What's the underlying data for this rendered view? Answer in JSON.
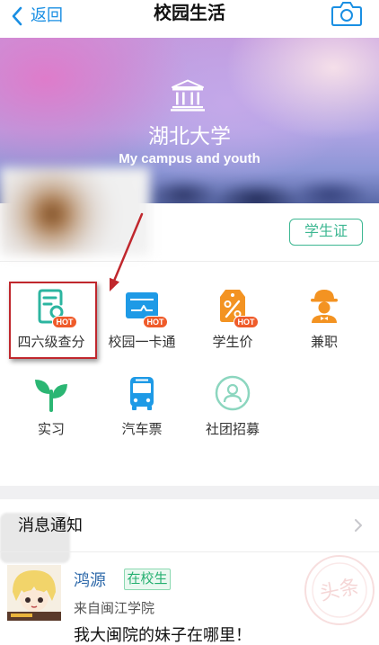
{
  "nav": {
    "back_label": "返回",
    "title": "校园生活",
    "back_icon": "chevron-left-icon",
    "camera_icon": "camera-icon"
  },
  "banner": {
    "icon": "university-building-icon",
    "school_name": "湖北大学",
    "slogan": "My campus and youth"
  },
  "profile": {
    "student_card_label": "学生证"
  },
  "services": {
    "items": [
      {
        "label": "四六级查分",
        "icon": "exam-score-search-icon",
        "badge": "HOT",
        "highlighted": true
      },
      {
        "label": "校园一卡通",
        "icon": "campus-card-icon",
        "badge": "HOT"
      },
      {
        "label": "学生价",
        "icon": "student-discount-tag-icon",
        "badge": "HOT"
      },
      {
        "label": "兼职",
        "icon": "part-time-worker-icon"
      },
      {
        "label": "实习",
        "icon": "internship-sprout-icon"
      },
      {
        "label": "汽车票",
        "icon": "bus-icon"
      },
      {
        "label": "社团招募",
        "icon": "club-recruit-icon"
      }
    ]
  },
  "notifications": {
    "title": "消息通知",
    "chevron_icon": "chevron-right-icon"
  },
  "post": {
    "author": "鸿源",
    "tag": "在校生",
    "source": "来自闽江学院",
    "text": "我大闽院的妹子在哪里！"
  },
  "watermark": {
    "text": "头条"
  },
  "colors": {
    "accent_blue": "#1a8fe3",
    "student_green": "#3db792",
    "hot_badge": "#ef5b2a",
    "icon_orange": "#f39322",
    "icon_teal": "#2cb5a0",
    "icon_green": "#2bb673",
    "icon_blue": "#1e9ae6",
    "annotation_red": "#c0272d"
  }
}
